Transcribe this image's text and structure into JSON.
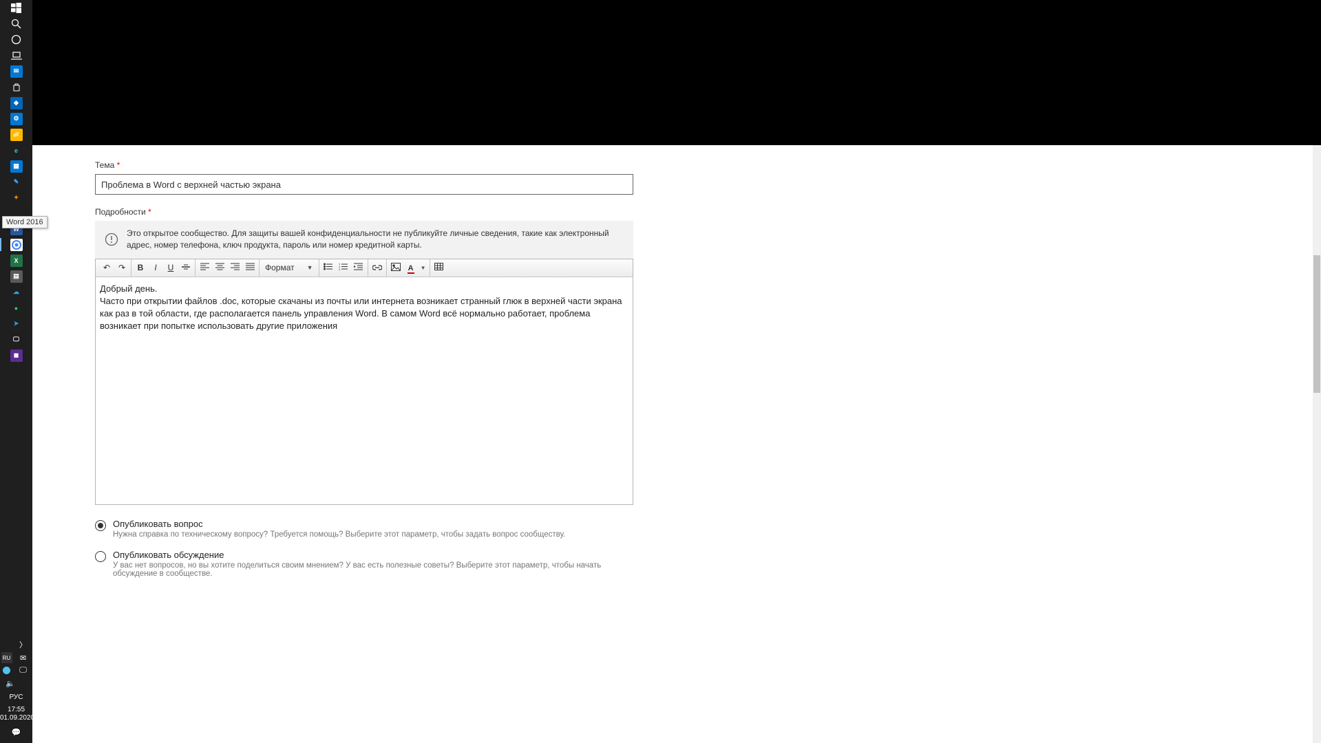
{
  "taskbar": {
    "tooltip": "Word 2016",
    "lang": "РУС",
    "time": "17:55",
    "date": "01.09.2020"
  },
  "form": {
    "subject_label": "Тема",
    "subject_value": "Проблема в Word с верхней частью экрана",
    "details_label": "Подробности",
    "privacy_notice": "Это открытое сообщество. Для защиты вашей конфиденциальности не публикуйте личные сведения, такие как электронный адрес, номер телефона, ключ продукта, пароль или номер кредитной карты.",
    "format_label": "Формат",
    "body_line1": "Добрый день.",
    "body_line2": "Часто при открытии файлов .doc, которые скачаны из почты или интернета возникает странный глюк в верхней части экрана как раз в той области, где располагается панель управления Word. В самом Word всё нормально работает, проблема возникает при попытке использовать другие приложения"
  },
  "options": {
    "question_title": "Опубликовать вопрос",
    "question_desc": "Нужна справка по техническому вопросу? Требуется помощь? Выберите этот параметр, чтобы задать вопрос сообществу.",
    "discussion_title": "Опубликовать обсуждение",
    "discussion_desc": "У вас нет вопросов, но вы хотите поделиться своим мнением? У вас есть полезные советы? Выберите этот параметр, чтобы начать обсуждение в сообществе."
  }
}
